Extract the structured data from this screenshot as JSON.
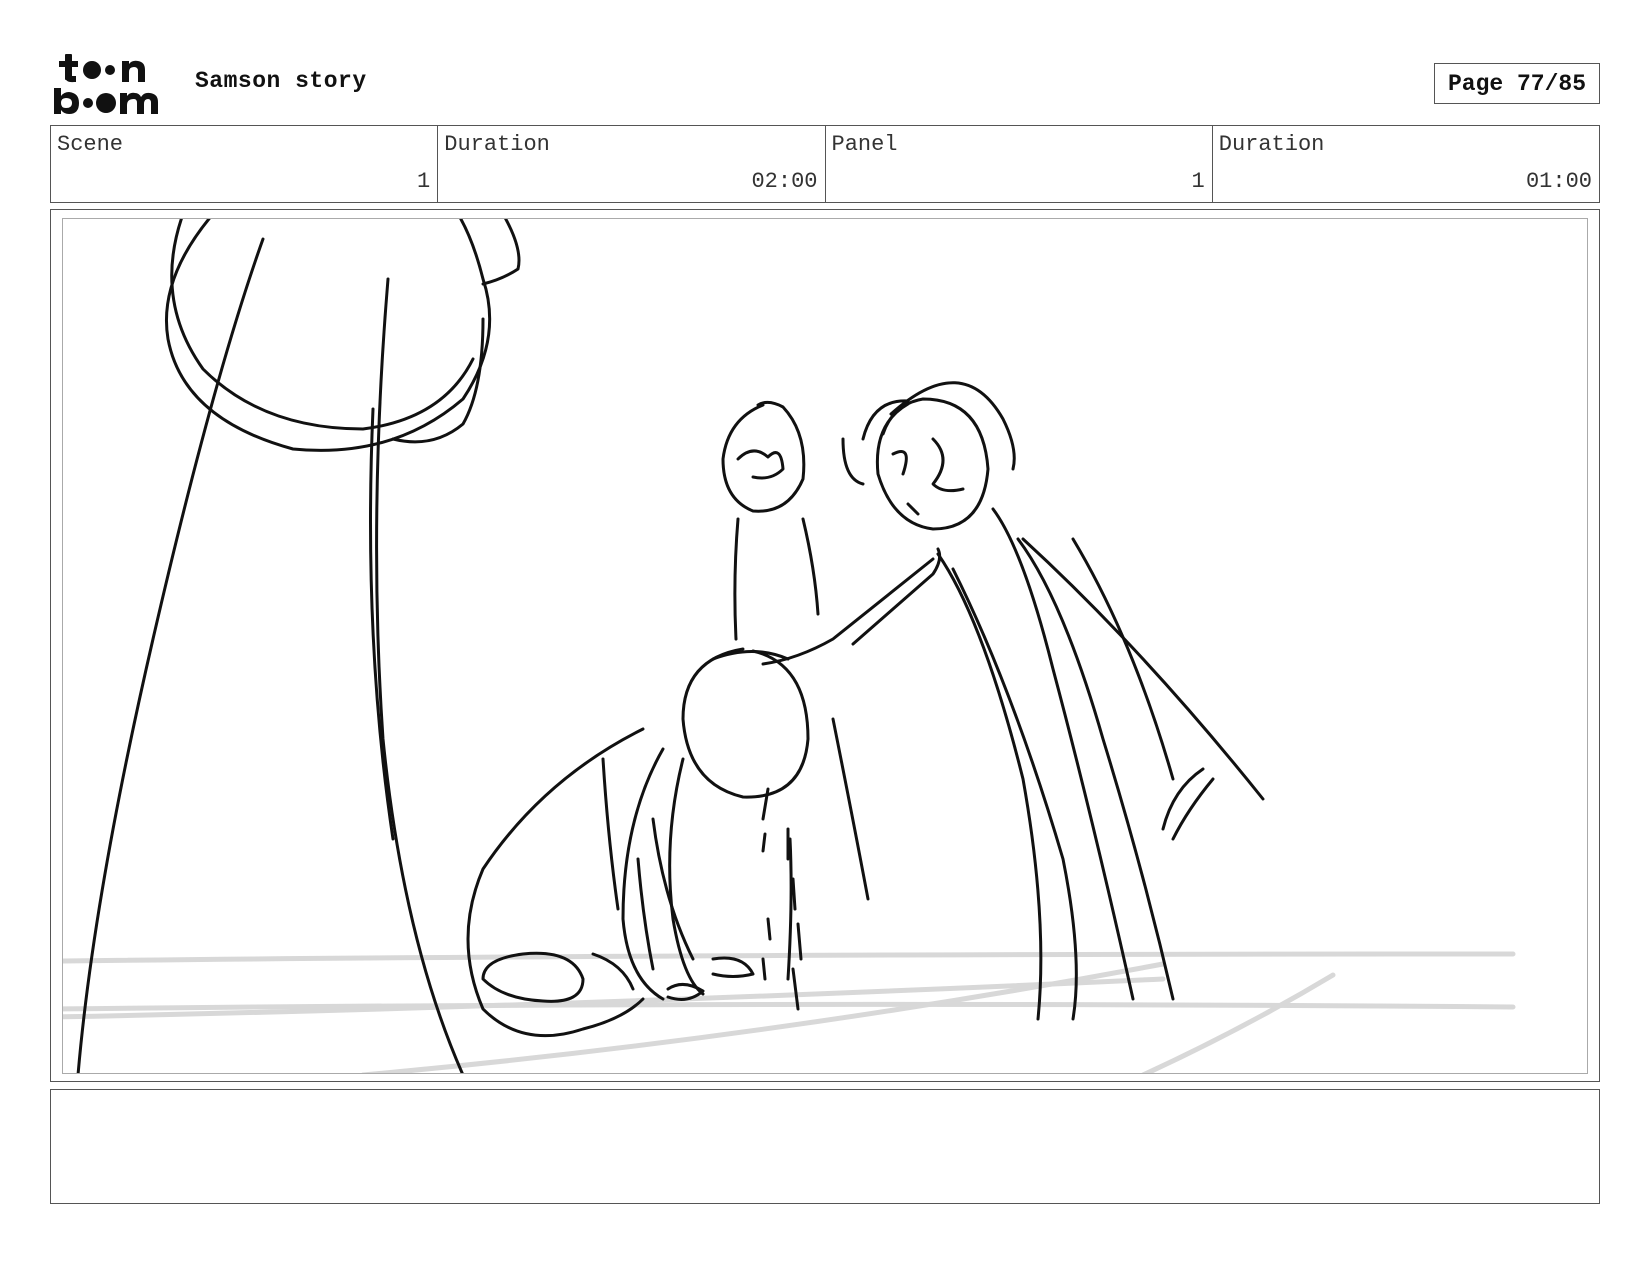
{
  "header": {
    "logo_alt": "toonboom",
    "project_title": "Samson story",
    "page_label": "Page 77/85"
  },
  "info": {
    "scene_label": "Scene",
    "scene_value": "1",
    "scene_duration_label": "Duration",
    "scene_duration_value": "02:00",
    "panel_label": "Panel",
    "panel_value": "1",
    "panel_duration_label": "Duration",
    "panel_duration_value": "01:00"
  },
  "notes": {
    "text": ""
  }
}
